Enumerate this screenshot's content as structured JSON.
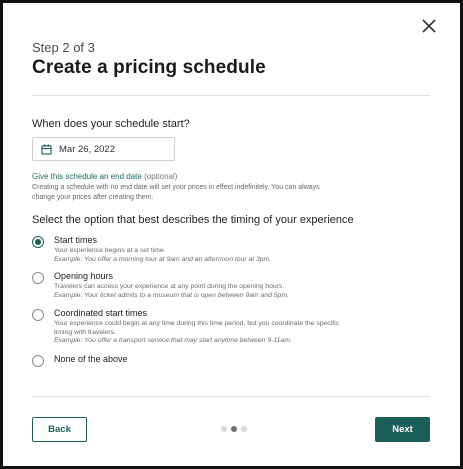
{
  "header": {
    "step": "Step 2 of 3",
    "title": "Create a pricing schedule"
  },
  "start": {
    "question": "When does your schedule start?",
    "date_value": "Mar 26, 2022",
    "end_date_link": "Give this schedule an end date",
    "end_date_optional": "(optional)",
    "helper": "Creating a schedule with no end date will set your prices in effect indefinitely. You can always change your prices after creating them."
  },
  "timing": {
    "question": "Select the option that best describes the timing of your experience",
    "options": [
      {
        "label": "Start times",
        "description": "Your experience begins at a set time.",
        "example": "Example: You offer a morning tour at 9am and an afternoon tour at 3pm.",
        "checked": true
      },
      {
        "label": "Opening hours",
        "description": "Travelers can access your experience at any point during the opening hours.",
        "example": "Example: Your ticket admits to a museum that is open between 9am and 5pm.",
        "checked": false
      },
      {
        "label": "Coordinated start times",
        "description": "Your experience could begin at any time during this time period, but you coordinate the specific timing with travelers.",
        "example": "Example: You offer a transport service that may start anytime between 9-11am.",
        "checked": false
      },
      {
        "label": "None of the above",
        "description": "",
        "example": "",
        "checked": false
      }
    ]
  },
  "footer": {
    "back_label": "Back",
    "next_label": "Next",
    "pagination": {
      "total": 3,
      "current": 2
    }
  },
  "colors": {
    "accent": "#1b5f5a",
    "link": "#1b6b64",
    "divider": "#e3e3e3"
  },
  "icons": {
    "close": "close-icon",
    "calendar": "calendar-icon"
  }
}
